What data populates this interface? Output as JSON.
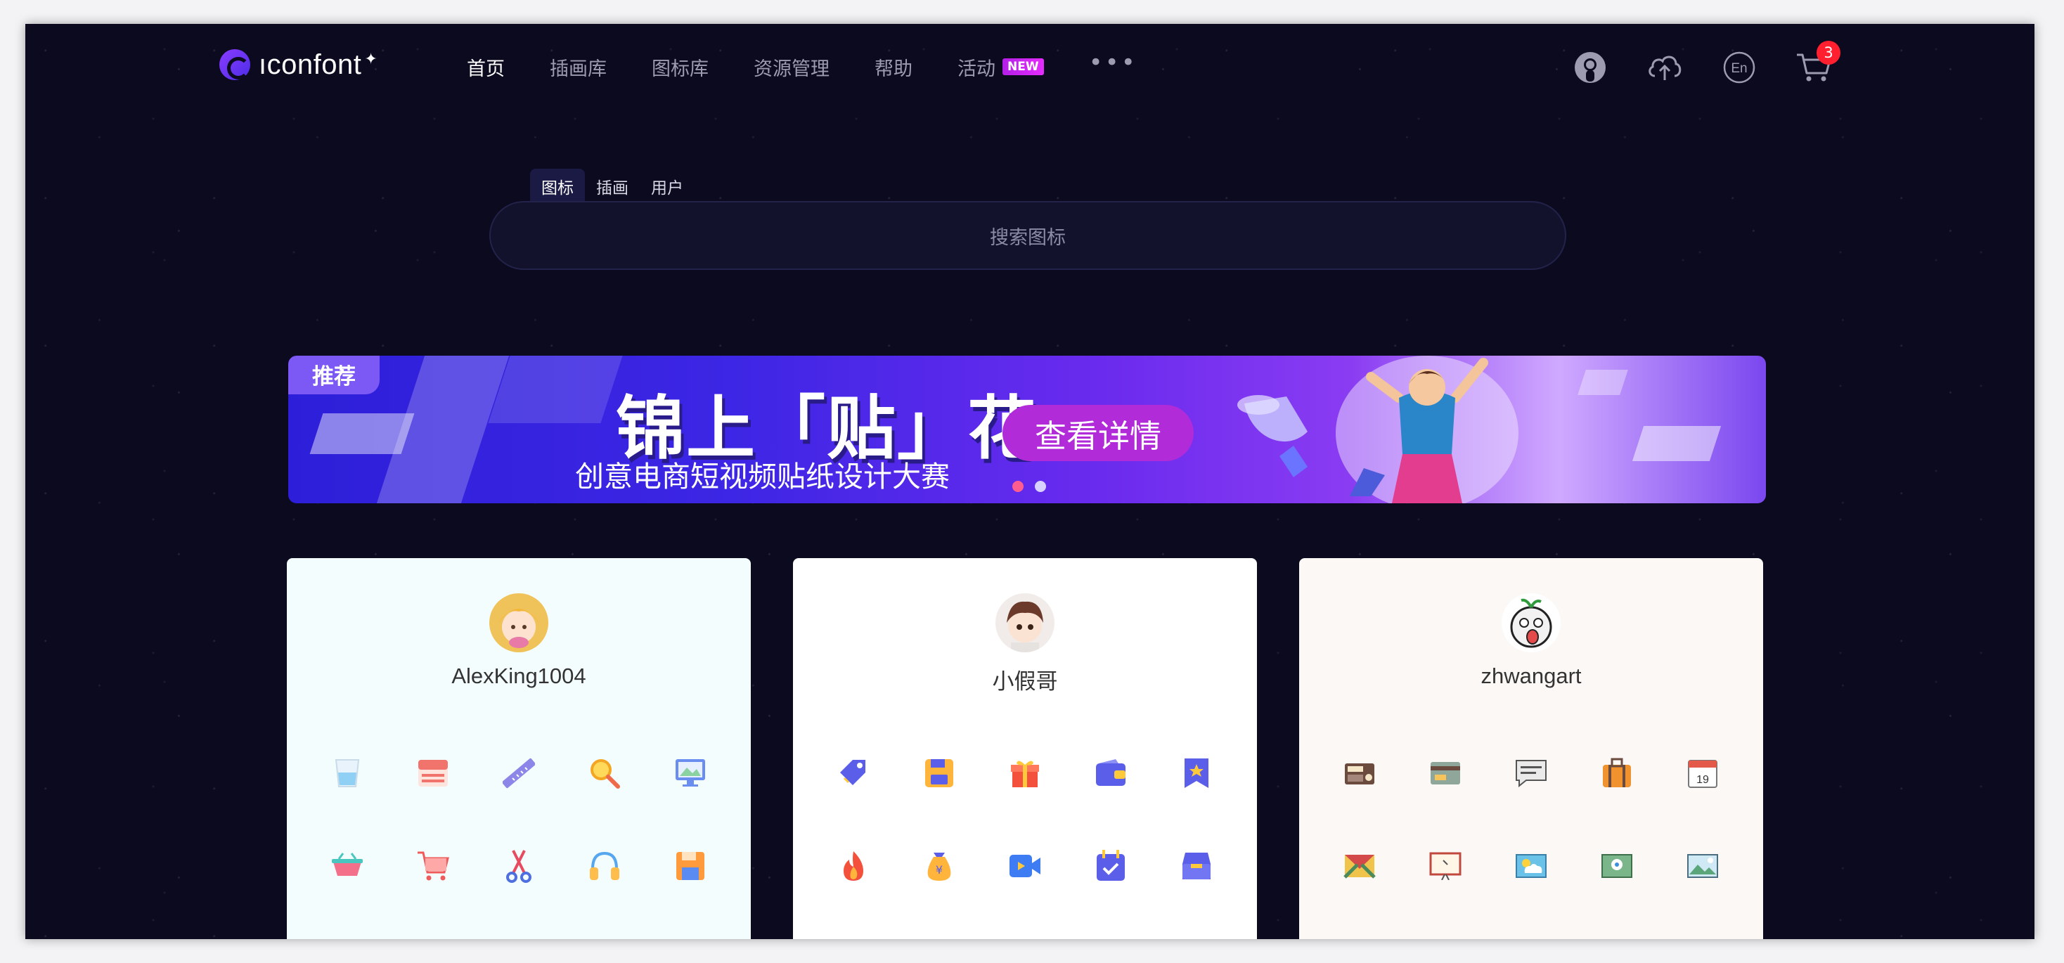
{
  "header": {
    "logo_text": "ıconfont",
    "logo_mark": "iconfont-logo-icon",
    "nav": [
      {
        "label": "首页",
        "active": true
      },
      {
        "label": "插画库",
        "active": false
      },
      {
        "label": "图标库",
        "active": false
      },
      {
        "label": "资源管理",
        "active": false
      },
      {
        "label": "帮助",
        "active": false
      },
      {
        "label": "活动",
        "active": false,
        "badge": "NEW"
      }
    ],
    "more": "•••",
    "actions": [
      {
        "name": "github-icon"
      },
      {
        "name": "upload-cloud-icon"
      },
      {
        "name": "language-en-icon",
        "text": "En"
      },
      {
        "name": "cart-icon",
        "count": "3"
      }
    ]
  },
  "search": {
    "tabs": [
      {
        "label": "图标",
        "active": true
      },
      {
        "label": "插画",
        "active": false
      },
      {
        "label": "用户",
        "active": false
      }
    ],
    "placeholder": "搜索图标"
  },
  "banner": {
    "tag": "推荐",
    "title": "锦上「贴」花",
    "subtitle": "创意电商短视频贴纸设计大赛",
    "button": "查看详情",
    "slides": 2,
    "active_slide": 0
  },
  "cards": [
    {
      "username": "AlexKing1004",
      "bg": "#f3fdfd",
      "icons": [
        "glass-icon",
        "keyboard-icon",
        "ruler-icon",
        "magnifier-icon",
        "monitor-icon",
        "basket-icon",
        "shopping-cart-icon",
        "scissors-icon",
        "headphones-icon",
        "floppy-disk-icon"
      ]
    },
    {
      "username": "小假哥",
      "bg": "#ffffff",
      "icons": [
        "price-tag-icon",
        "save-disk-icon",
        "gift-icon",
        "wallet-icon",
        "bookmark-star-icon",
        "fire-icon",
        "money-bag-icon",
        "video-camera-icon",
        "calendar-check-icon",
        "inbox-icon"
      ]
    },
    {
      "username": "zhwangart",
      "bg": "#fcf8f6",
      "icons": [
        "radio-icon",
        "credit-card-icon",
        "message-icon",
        "suitcase-icon",
        "calendar-icon",
        "mail-icon",
        "presentation-icon",
        "weather-icon",
        "map-pin-icon",
        "picture-icon"
      ]
    }
  ],
  "calendar_day": "19"
}
